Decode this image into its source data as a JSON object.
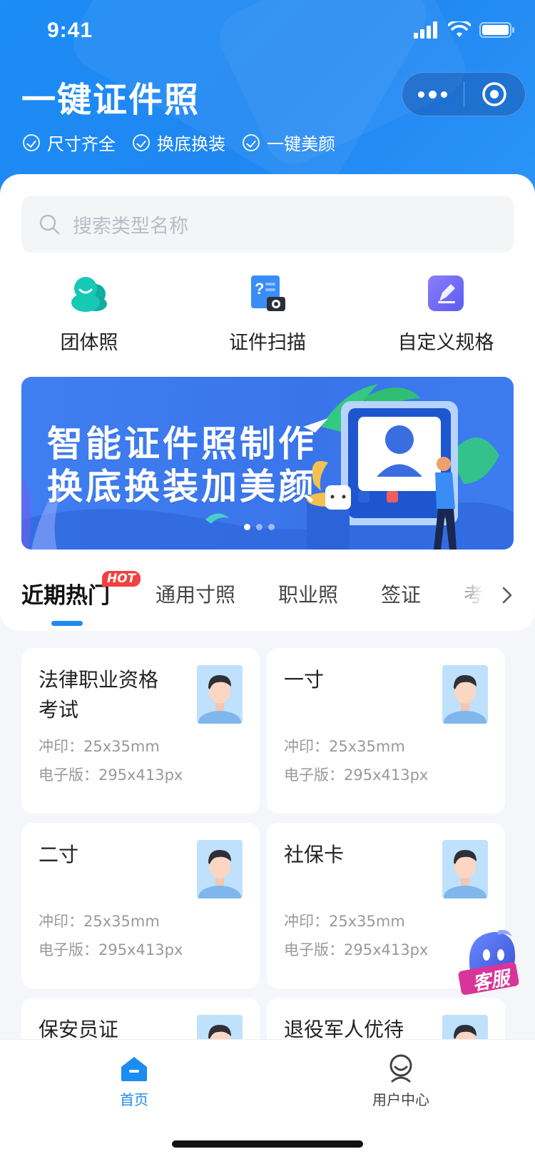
{
  "status_bar": {
    "time": "9:41"
  },
  "header": {
    "title": "一键证件照",
    "features": [
      "尺寸齐全",
      "换底换装",
      "一键美颜"
    ]
  },
  "search": {
    "placeholder": "搜索类型名称"
  },
  "quick_actions": [
    {
      "label": "团体照",
      "icon": "group-photo-icon"
    },
    {
      "label": "证件扫描",
      "icon": "document-scan-icon"
    },
    {
      "label": "自定义规格",
      "icon": "custom-spec-icon"
    }
  ],
  "banner": {
    "line1": "智能证件照制作",
    "line2": "换底换装加美颜",
    "slides": 3,
    "active_slide": 1
  },
  "tabs": {
    "items": [
      "近期热门",
      "通用寸照",
      "职业照",
      "签证",
      "考试"
    ],
    "active": "近期热门",
    "badge": "HOT"
  },
  "spec_labels": {
    "print": "冲印：",
    "digital": "电子版："
  },
  "cards": [
    {
      "title": "法律职业资格考试",
      "print": "25x35mm",
      "digital": "295x413px"
    },
    {
      "title": "一寸",
      "print": "25x35mm",
      "digital": "295x413px"
    },
    {
      "title": "二寸",
      "print": "25x35mm",
      "digital": "295x413px"
    },
    {
      "title": "社保卡",
      "print": "25x35mm",
      "digital": "295x413px"
    },
    {
      "title": "保安员证",
      "print": "",
      "digital": ""
    },
    {
      "title": "退役军人优待",
      "print": "",
      "digital": ""
    }
  ],
  "customer_service": {
    "label": "客服"
  },
  "bottom_nav": [
    {
      "label": "首页",
      "icon": "home-icon",
      "active": true
    },
    {
      "label": "用户中心",
      "icon": "user-center-icon",
      "active": false
    }
  ],
  "colors": {
    "primary": "#1c8bf2",
    "hot": "#f4403f",
    "teal": "#12c4b0"
  }
}
